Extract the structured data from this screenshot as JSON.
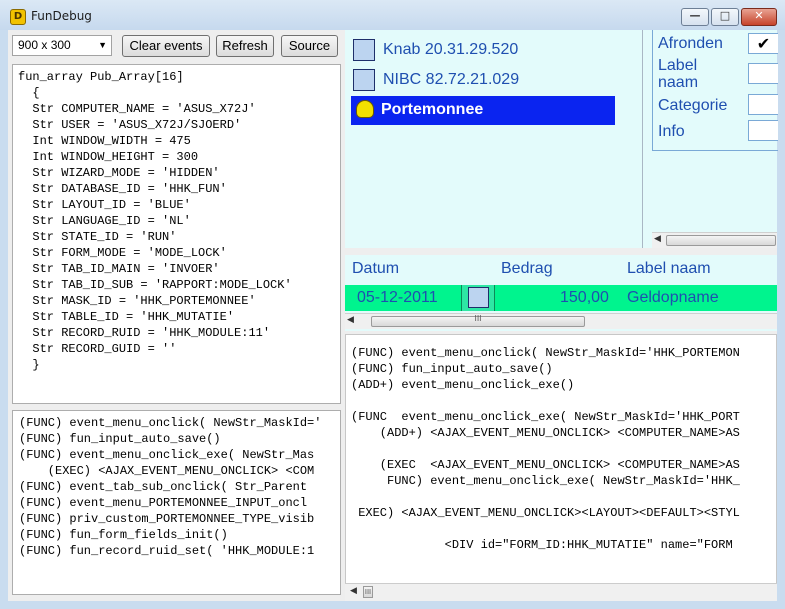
{
  "window": {
    "title": "FunDebug",
    "app_icon_letter": "D"
  },
  "toolbar": {
    "size_select": "900 x 300",
    "clear_label": "Clear events",
    "refresh_label": "Refresh",
    "source_label": "Source"
  },
  "array_dump": [
    "fun_array Pub_Array[16]",
    "  {",
    "  Str COMPUTER_NAME = 'ASUS_X72J'",
    "  Str USER = 'ASUS_X72J/SJOERD'",
    "  Int WINDOW_WIDTH = 475",
    "  Int WINDOW_HEIGHT = 300",
    "  Str WIZARD_MODE = 'HIDDEN'",
    "  Str DATABASE_ID = 'HHK_FUN'",
    "  Str LAYOUT_ID = 'BLUE'",
    "  Str LANGUAGE_ID = 'NL'",
    "  Str STATE_ID = 'RUN'",
    "  Str FORM_MODE = 'MODE_LOCK'",
    "  Str TAB_ID_MAIN = 'INVOER'",
    "  Str TAB_ID_SUB = 'RAPPORT:MODE_LOCK'",
    "  Str MASK_ID = 'HHK_PORTEMONNEE'",
    "  Str TABLE_ID = 'HHK_MUTATIE'",
    "  Str RECORD_RUID = 'HHK_MODULE:11'",
    "  Str RECORD_GUID = ''",
    "  }"
  ],
  "event_log": [
    "(FUNC) event_menu_onclick( NewStr_MaskId='",
    "(FUNC) fun_input_auto_save()",
    "(FUNC) event_menu_onclick_exe( NewStr_Mas",
    "    (EXEC) <AJAX_EVENT_MENU_ONCLICK> <COM",
    "(FUNC) event_tab_sub_onclick( Str_Parent",
    "(FUNC) event_menu_PORTEMONNEE_INPUT_oncl",
    "(FUNC) priv_custom_PORTEMONNEE_TYPE_visib",
    "(FUNC) fun_form_fields_init()",
    "(FUNC) fun_record_ruid_set( 'HHK_MODULE:1"
  ],
  "accounts": [
    {
      "label": "Knab 20.31.29.520",
      "icon": "bank-icon"
    },
    {
      "label": "NIBC 82.72.21.029",
      "icon": "bank-icon"
    },
    {
      "label": "Portemonnee",
      "icon": "wallet-icon",
      "selected": true
    }
  ],
  "form": {
    "afronden_label": "Afronden",
    "afronden_checked": "✔",
    "label_naam_label": "Label\nnaam",
    "categorie_label": "Categorie",
    "info_label": "Info"
  },
  "table": {
    "headers": [
      "Datum",
      "Bedrag",
      "Label naam"
    ],
    "rows": [
      {
        "datum": "05-12-2011",
        "bedrag": "150,00",
        "label": "Geldopname"
      }
    ]
  },
  "source_log": [
    "(FUNC) event_menu_onclick( NewStr_MaskId='HHK_PORTEMON",
    "(FUNC) fun_input_auto_save()",
    "(ADD+) event_menu_onclick_exe()",
    "",
    "(FUNC  event_menu_onclick_exe( NewStr_MaskId='HHK_PORT",
    "    (ADD+) <AJAX_EVENT_MENU_ONCLICK> <COMPUTER_NAME>AS",
    "",
    "    (EXEC  <AJAX_EVENT_MENU_ONCLICK> <COMPUTER_NAME>AS",
    "     FUNC) event_menu_onclick_exe( NewStr_MaskId='HHK_",
    "",
    " EXEC) <AJAX_EVENT_MENU_ONCLICK><LAYOUT><DEFAULT><STYL",
    "",
    "             <DIV id=\"FORM_ID:HHK_MUTATIE\" name=\"FORM"
  ],
  "colors": {
    "accent_blue": "#0a24f0",
    "panel_bg": "#e3fbfb",
    "row_green": "#00f48e"
  }
}
